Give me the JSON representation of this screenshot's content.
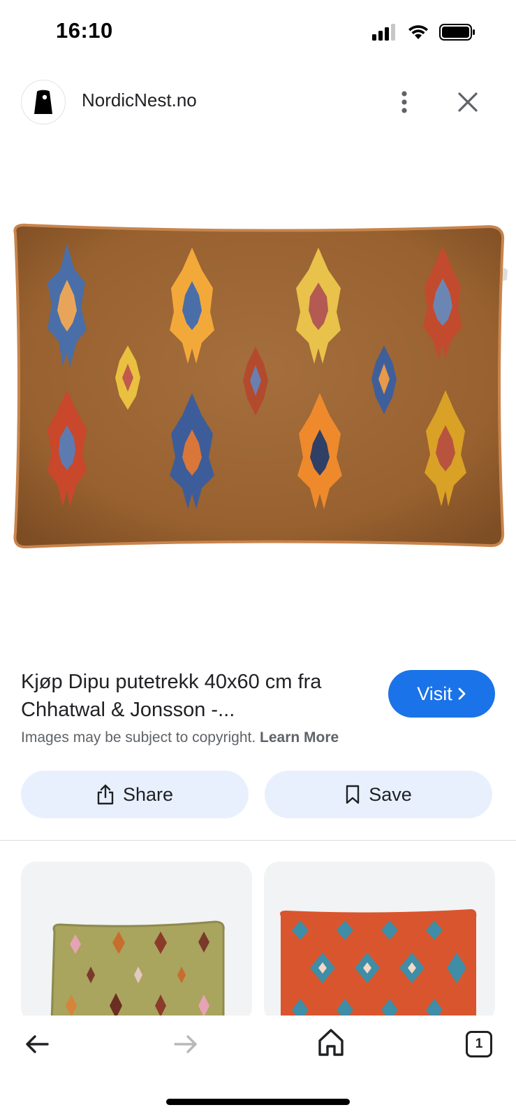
{
  "status_bar": {
    "time": "16:10",
    "icons": [
      "cellular-signal-icon",
      "wifi-icon",
      "battery-icon"
    ]
  },
  "header": {
    "site_name": "NordicNest.no",
    "logo_icon": "nordicnest-logo",
    "more_icon": "more-vert-icon",
    "close_icon": "close-icon"
  },
  "main_image": {
    "subject": "brown velvet cushion with embroidered ikat motifs"
  },
  "result": {
    "title": "Kjøp Dipu putetrekk 40x60 cm fra Chhatwal & Jonsson -...",
    "visit_label": "Visit",
    "copyright_text": "Images may be subject to copyright.",
    "learn_more": "Learn More"
  },
  "actions": {
    "share_label": "Share",
    "save_label": "Save"
  },
  "related": [
    {
      "subject": "green cushion with ikat motifs"
    },
    {
      "subject": "orange and blue ikat cushion"
    }
  ],
  "bottom_nav": {
    "tab_count": "1"
  },
  "colors": {
    "accent": "#1a73e8",
    "chip_bg": "#e8f0fe",
    "pillow_brown": "#a06a3a"
  }
}
